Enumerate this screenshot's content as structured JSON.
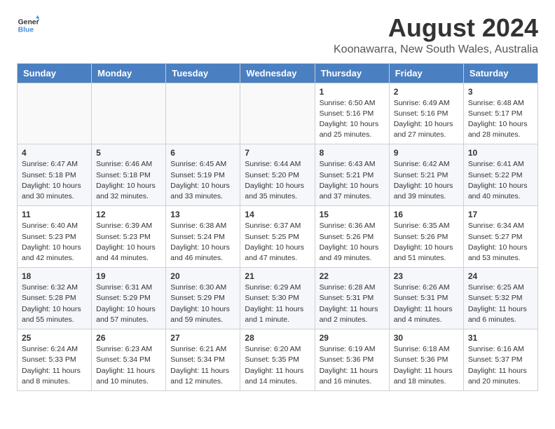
{
  "header": {
    "logo_line1": "General",
    "logo_line2": "Blue",
    "month_year": "August 2024",
    "location": "Koonawarra, New South Wales, Australia"
  },
  "weekdays": [
    "Sunday",
    "Monday",
    "Tuesday",
    "Wednesday",
    "Thursday",
    "Friday",
    "Saturday"
  ],
  "weeks": [
    [
      {
        "day": "",
        "info": ""
      },
      {
        "day": "",
        "info": ""
      },
      {
        "day": "",
        "info": ""
      },
      {
        "day": "",
        "info": ""
      },
      {
        "day": "1",
        "info": "Sunrise: 6:50 AM\nSunset: 5:16 PM\nDaylight: 10 hours\nand 25 minutes."
      },
      {
        "day": "2",
        "info": "Sunrise: 6:49 AM\nSunset: 5:16 PM\nDaylight: 10 hours\nand 27 minutes."
      },
      {
        "day": "3",
        "info": "Sunrise: 6:48 AM\nSunset: 5:17 PM\nDaylight: 10 hours\nand 28 minutes."
      }
    ],
    [
      {
        "day": "4",
        "info": "Sunrise: 6:47 AM\nSunset: 5:18 PM\nDaylight: 10 hours\nand 30 minutes."
      },
      {
        "day": "5",
        "info": "Sunrise: 6:46 AM\nSunset: 5:18 PM\nDaylight: 10 hours\nand 32 minutes."
      },
      {
        "day": "6",
        "info": "Sunrise: 6:45 AM\nSunset: 5:19 PM\nDaylight: 10 hours\nand 33 minutes."
      },
      {
        "day": "7",
        "info": "Sunrise: 6:44 AM\nSunset: 5:20 PM\nDaylight: 10 hours\nand 35 minutes."
      },
      {
        "day": "8",
        "info": "Sunrise: 6:43 AM\nSunset: 5:21 PM\nDaylight: 10 hours\nand 37 minutes."
      },
      {
        "day": "9",
        "info": "Sunrise: 6:42 AM\nSunset: 5:21 PM\nDaylight: 10 hours\nand 39 minutes."
      },
      {
        "day": "10",
        "info": "Sunrise: 6:41 AM\nSunset: 5:22 PM\nDaylight: 10 hours\nand 40 minutes."
      }
    ],
    [
      {
        "day": "11",
        "info": "Sunrise: 6:40 AM\nSunset: 5:23 PM\nDaylight: 10 hours\nand 42 minutes."
      },
      {
        "day": "12",
        "info": "Sunrise: 6:39 AM\nSunset: 5:23 PM\nDaylight: 10 hours\nand 44 minutes."
      },
      {
        "day": "13",
        "info": "Sunrise: 6:38 AM\nSunset: 5:24 PM\nDaylight: 10 hours\nand 46 minutes."
      },
      {
        "day": "14",
        "info": "Sunrise: 6:37 AM\nSunset: 5:25 PM\nDaylight: 10 hours\nand 47 minutes."
      },
      {
        "day": "15",
        "info": "Sunrise: 6:36 AM\nSunset: 5:26 PM\nDaylight: 10 hours\nand 49 minutes."
      },
      {
        "day": "16",
        "info": "Sunrise: 6:35 AM\nSunset: 5:26 PM\nDaylight: 10 hours\nand 51 minutes."
      },
      {
        "day": "17",
        "info": "Sunrise: 6:34 AM\nSunset: 5:27 PM\nDaylight: 10 hours\nand 53 minutes."
      }
    ],
    [
      {
        "day": "18",
        "info": "Sunrise: 6:32 AM\nSunset: 5:28 PM\nDaylight: 10 hours\nand 55 minutes."
      },
      {
        "day": "19",
        "info": "Sunrise: 6:31 AM\nSunset: 5:29 PM\nDaylight: 10 hours\nand 57 minutes."
      },
      {
        "day": "20",
        "info": "Sunrise: 6:30 AM\nSunset: 5:29 PM\nDaylight: 10 hours\nand 59 minutes."
      },
      {
        "day": "21",
        "info": "Sunrise: 6:29 AM\nSunset: 5:30 PM\nDaylight: 11 hours\nand 1 minute."
      },
      {
        "day": "22",
        "info": "Sunrise: 6:28 AM\nSunset: 5:31 PM\nDaylight: 11 hours\nand 2 minutes."
      },
      {
        "day": "23",
        "info": "Sunrise: 6:26 AM\nSunset: 5:31 PM\nDaylight: 11 hours\nand 4 minutes."
      },
      {
        "day": "24",
        "info": "Sunrise: 6:25 AM\nSunset: 5:32 PM\nDaylight: 11 hours\nand 6 minutes."
      }
    ],
    [
      {
        "day": "25",
        "info": "Sunrise: 6:24 AM\nSunset: 5:33 PM\nDaylight: 11 hours\nand 8 minutes."
      },
      {
        "day": "26",
        "info": "Sunrise: 6:23 AM\nSunset: 5:34 PM\nDaylight: 11 hours\nand 10 minutes."
      },
      {
        "day": "27",
        "info": "Sunrise: 6:21 AM\nSunset: 5:34 PM\nDaylight: 11 hours\nand 12 minutes."
      },
      {
        "day": "28",
        "info": "Sunrise: 6:20 AM\nSunset: 5:35 PM\nDaylight: 11 hours\nand 14 minutes."
      },
      {
        "day": "29",
        "info": "Sunrise: 6:19 AM\nSunset: 5:36 PM\nDaylight: 11 hours\nand 16 minutes."
      },
      {
        "day": "30",
        "info": "Sunrise: 6:18 AM\nSunset: 5:36 PM\nDaylight: 11 hours\nand 18 minutes."
      },
      {
        "day": "31",
        "info": "Sunrise: 6:16 AM\nSunset: 5:37 PM\nDaylight: 11 hours\nand 20 minutes."
      }
    ]
  ]
}
